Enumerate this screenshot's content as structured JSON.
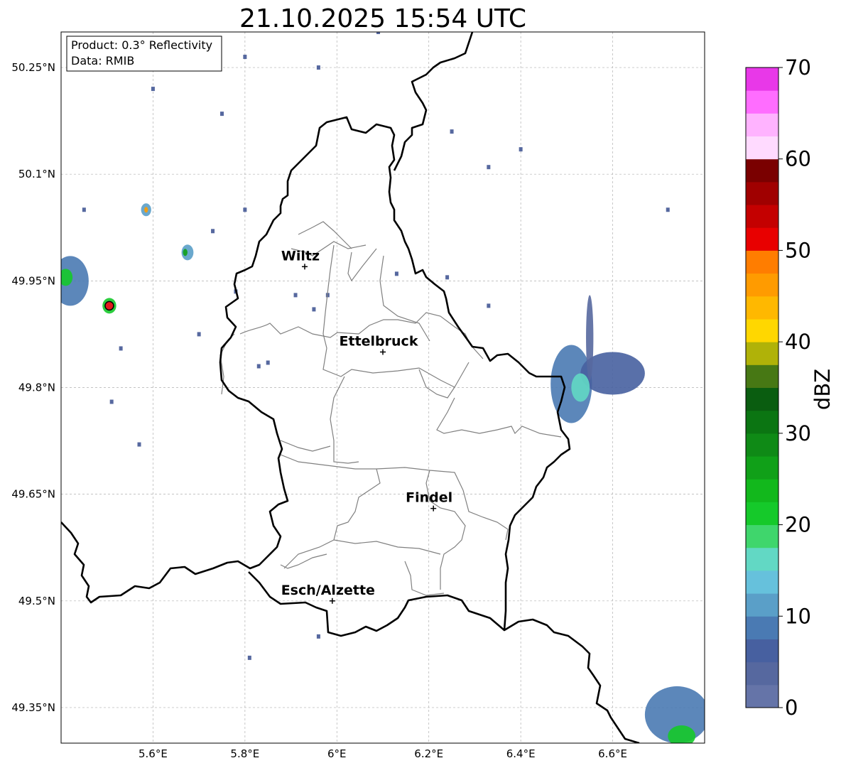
{
  "title": "21.10.2025 15:54 UTC",
  "info_box": {
    "product": "Product: 0.3° Reflectivity",
    "data": "Data: RMIB"
  },
  "axes": {
    "lon_range": [
      5.4,
      6.8
    ],
    "lat_range": [
      49.3,
      50.3
    ],
    "x_ticks": [
      {
        "value": 5.6,
        "label": "5.6°E"
      },
      {
        "value": 5.8,
        "label": "5.8°E"
      },
      {
        "value": 6.0,
        "label": "6°E"
      },
      {
        "value": 6.2,
        "label": "6.2°E"
      },
      {
        "value": 6.4,
        "label": "6.4°E"
      },
      {
        "value": 6.6,
        "label": "6.6°E"
      }
    ],
    "y_ticks": [
      {
        "value": 50.25,
        "label": "50.25°N"
      },
      {
        "value": 50.1,
        "label": "50.1°N"
      },
      {
        "value": 49.95,
        "label": "49.95°N"
      },
      {
        "value": 49.8,
        "label": "49.8°N"
      },
      {
        "value": 49.65,
        "label": "49.65°N"
      },
      {
        "value": 49.5,
        "label": "49.5°N"
      },
      {
        "value": 49.35,
        "label": "49.35°N"
      }
    ],
    "grid": true
  },
  "cities": [
    {
      "name": "Wiltz",
      "lon": 5.93,
      "lat": 49.97
    },
    {
      "name": "Ettelbruck",
      "lon": 6.1,
      "lat": 49.85
    },
    {
      "name": "Findel",
      "lon": 6.21,
      "lat": 49.63
    },
    {
      "name": "Esch/Alzette",
      "lon": 5.99,
      "lat": 49.5
    }
  ],
  "radar_site": {
    "lon": 5.505,
    "lat": 49.915,
    "color": "#e31a1c"
  },
  "colorbar": {
    "label": "dBZ",
    "min": 0,
    "max": 70,
    "ticks": [
      {
        "value": 0,
        "label": "0"
      },
      {
        "value": 10,
        "label": "10"
      },
      {
        "value": 20,
        "label": "20"
      },
      {
        "value": 30,
        "label": "30"
      },
      {
        "value": 40,
        "label": "40"
      },
      {
        "value": 50,
        "label": "50"
      },
      {
        "value": 60,
        "label": "60"
      },
      {
        "value": 70,
        "label": "70"
      }
    ],
    "colors": [
      "#6574a8",
      "#56689f",
      "#4760a0",
      "#4a7ab3",
      "#5a9fc8",
      "#66c1dc",
      "#62d8c4",
      "#3fd66c",
      "#15c92a",
      "#12b81c",
      "#10a018",
      "#0f8a16",
      "#0b7512",
      "#0a5d10",
      "#477814",
      "#b0b208",
      "#ffd700",
      "#ffb800",
      "#ff9b00",
      "#ff7d00",
      "#e80000",
      "#c40000",
      "#a00000",
      "#7a0000",
      "#ffdaff",
      "#ffb3ff",
      "#ff6dff",
      "#e838e8"
    ]
  },
  "echoes": [
    {
      "lon": 6.51,
      "lat": 49.805,
      "rx": 0.045,
      "ry": 0.055,
      "dbz": 8
    },
    {
      "lon": 6.6,
      "lat": 49.82,
      "rx": 0.07,
      "ry": 0.03,
      "dbz": 6
    },
    {
      "lon": 6.53,
      "lat": 49.8,
      "rx": 0.02,
      "ry": 0.02,
      "dbz": 15
    },
    {
      "lon": 6.55,
      "lat": 49.87,
      "rx": 0.008,
      "ry": 0.06,
      "dbz": 3
    },
    {
      "lon": 6.74,
      "lat": 49.34,
      "rx": 0.07,
      "ry": 0.04,
      "dbz": 8
    },
    {
      "lon": 6.75,
      "lat": 49.31,
      "rx": 0.03,
      "ry": 0.015,
      "dbz": 22
    },
    {
      "lon": 5.42,
      "lat": 49.95,
      "rx": 0.04,
      "ry": 0.035,
      "dbz": 9
    },
    {
      "lon": 5.41,
      "lat": 49.955,
      "rx": 0.015,
      "ry": 0.012,
      "dbz": 22
    },
    {
      "lon": 5.505,
      "lat": 49.915,
      "rx": 0.015,
      "ry": 0.011,
      "dbz": 22
    },
    {
      "lon": 5.675,
      "lat": 49.99,
      "rx": 0.013,
      "ry": 0.011,
      "dbz": 12
    },
    {
      "lon": 5.67,
      "lat": 49.99,
      "rx": 0.005,
      "ry": 0.005,
      "dbz": 25
    },
    {
      "lon": 5.585,
      "lat": 50.05,
      "rx": 0.011,
      "ry": 0.009,
      "dbz": 12
    },
    {
      "lon": 5.585,
      "lat": 50.05,
      "rx": 0.004,
      "ry": 0.004,
      "dbz": 45
    }
  ],
  "specks": [
    [
      5.8,
      50.265
    ],
    [
      5.71,
      50.265
    ],
    [
      5.75,
      50.185
    ],
    [
      5.96,
      50.25
    ],
    [
      6.25,
      50.16
    ],
    [
      6.4,
      50.135
    ],
    [
      6.33,
      50.11
    ],
    [
      6.72,
      50.05
    ],
    [
      5.73,
      50.02
    ],
    [
      5.8,
      50.05
    ],
    [
      6.24,
      49.955
    ],
    [
      6.13,
      49.96
    ],
    [
      5.91,
      49.93
    ],
    [
      5.98,
      49.93
    ],
    [
      5.95,
      49.91
    ],
    [
      6.33,
      49.915
    ],
    [
      5.7,
      49.875
    ],
    [
      5.83,
      49.83
    ],
    [
      5.78,
      49.935
    ],
    [
      5.85,
      49.835
    ],
    [
      5.57,
      49.72
    ],
    [
      5.53,
      49.855
    ],
    [
      5.6,
      50.22
    ],
    [
      6.09,
      50.3
    ],
    [
      5.81,
      49.42
    ],
    [
      5.96,
      49.45
    ],
    [
      5.51,
      49.78
    ],
    [
      5.45,
      50.05
    ]
  ]
}
